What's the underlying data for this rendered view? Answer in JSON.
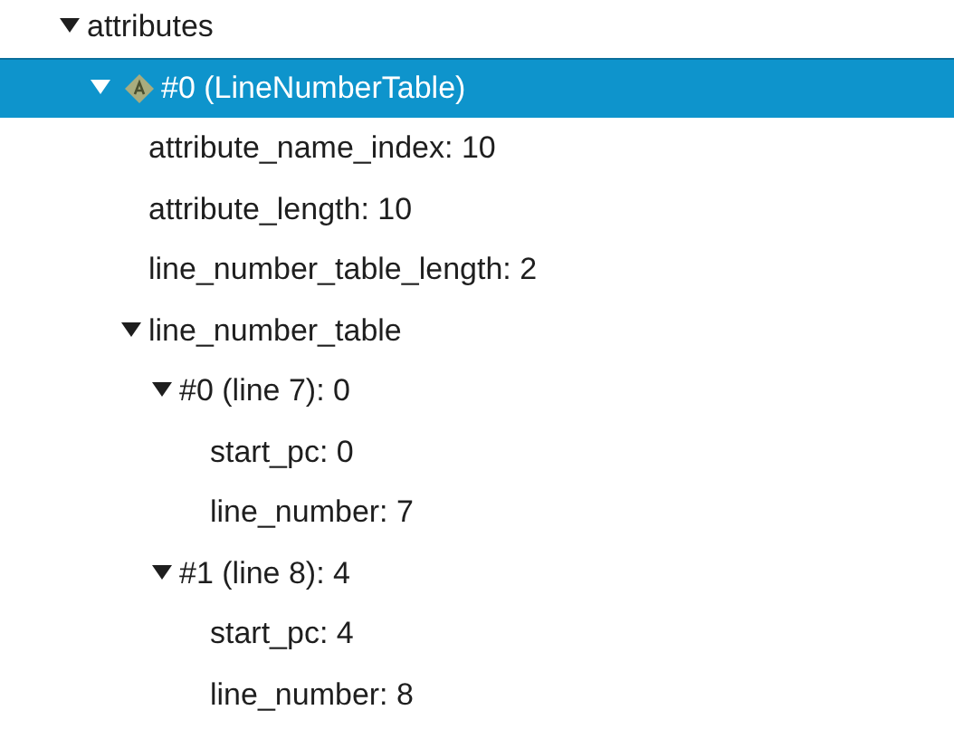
{
  "tree": [
    {
      "label": "attributes",
      "expanded": true,
      "selected": false,
      "children": [
        {
          "label": "#0 (LineNumberTable)",
          "expanded": true,
          "selected": true,
          "kind": "attribute",
          "children": [
            {
              "label": "attribute_name_index: 10",
              "selected": false
            },
            {
              "label": "attribute_length: 10",
              "selected": false
            },
            {
              "label": "line_number_table_length: 2",
              "selected": false
            },
            {
              "label": "line_number_table",
              "expanded": true,
              "selected": false,
              "children": [
                {
                  "label": "#0 (line 7): 0",
                  "expanded": true,
                  "selected": false,
                  "children": [
                    {
                      "label": "start_pc: 0",
                      "selected": false
                    },
                    {
                      "label": "line_number: 7",
                      "selected": false
                    }
                  ]
                },
                {
                  "label": "#1 (line 8): 4",
                  "expanded": true,
                  "selected": false,
                  "children": [
                    {
                      "label": "start_pc: 4",
                      "selected": false
                    },
                    {
                      "label": "line_number: 8",
                      "selected": false
                    }
                  ]
                }
              ]
            }
          ]
        }
      ]
    }
  ]
}
